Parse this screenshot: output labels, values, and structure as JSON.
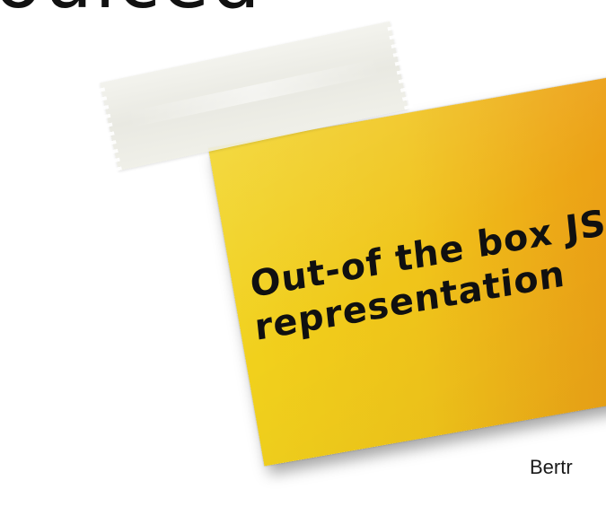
{
  "slide": {
    "top_fragment": "ouiced",
    "note_text": "Out-of the box JSON representation",
    "author_fragment": "Bertr"
  },
  "colors": {
    "note_yellow": "#f1d21c",
    "note_orange": "#e99312",
    "tape": "#ecece4",
    "text": "#101010"
  }
}
